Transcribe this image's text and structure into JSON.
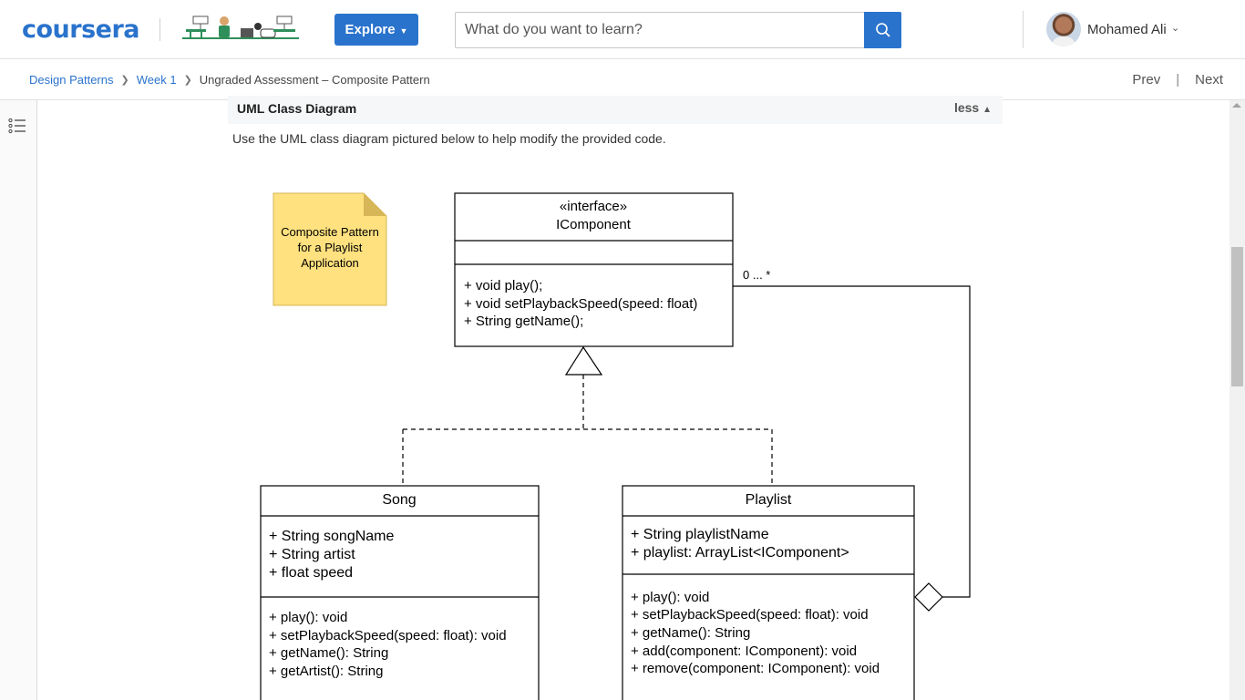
{
  "header": {
    "logo": "coursera",
    "explore_label": "Explore",
    "search_placeholder": "What do you want to learn?",
    "user_name": "Mohamed Ali"
  },
  "breadcrumb": {
    "items": [
      "Design Patterns",
      "Week 1"
    ],
    "current": "Ungraded Assessment – Composite Pattern"
  },
  "nav": {
    "prev": "Prev",
    "next": "Next"
  },
  "content": {
    "section_title": "UML Class Diagram",
    "toggle_label": "less",
    "instruction": "Use the UML class diagram pictured below to help modify the provided code."
  },
  "diagram": {
    "note": [
      "Composite Pattern",
      "for a Playlist",
      "Application"
    ],
    "interface": {
      "stereotype": "«interface»",
      "name": "IComponent",
      "methods": [
        "+ void play();",
        "+ void setPlaybackSpeed(speed: float)",
        "+ String getName();"
      ]
    },
    "multiplicity": "0 ... *",
    "song": {
      "name": "Song",
      "attributes": [
        "+ String songName",
        "+ String artist",
        "+ float speed"
      ],
      "methods": [
        "+ play(): void",
        "+ setPlaybackSpeed(speed: float): void",
        "+ getName(): String",
        "+ getArtist(): String"
      ]
    },
    "playlist": {
      "name": "Playlist",
      "attributes": [
        "+ String playlistName",
        "+ playlist: ArrayList<IComponent>"
      ],
      "methods": [
        "+ play(): void",
        "+ setPlaybackSpeed(speed: float): void",
        "+ getName(): String",
        "+ add(component: IComponent): void",
        "+ remove(component: IComponent): void"
      ]
    }
  }
}
